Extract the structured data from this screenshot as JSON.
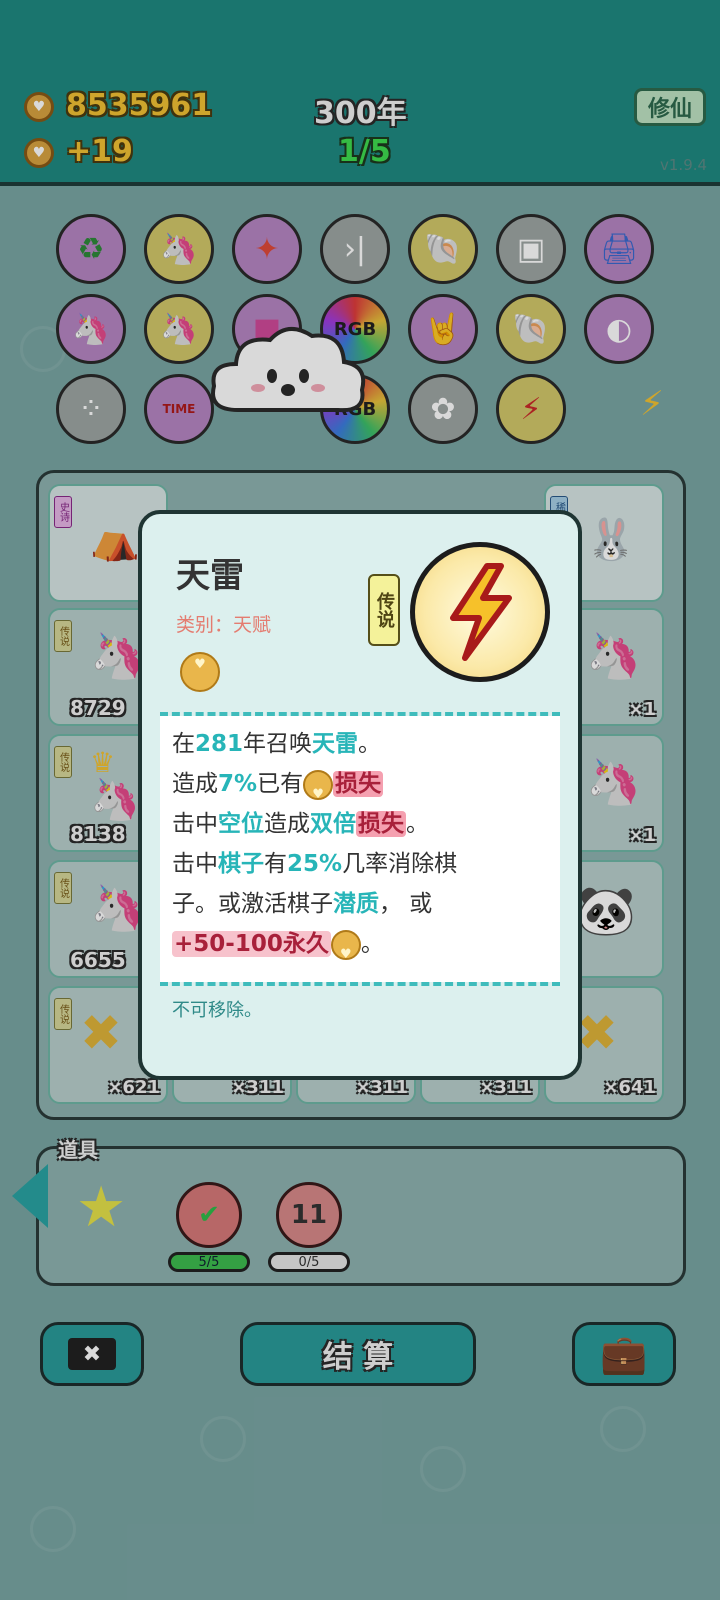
{
  "header": {
    "coins": "8535961",
    "income": "+19",
    "year": "300年",
    "progress": "1/5",
    "cultivate_label": "修仙",
    "version": "v1.9.4"
  },
  "item_bar": {
    "rows": [
      [
        "recycle-icon",
        "unicorn-icon",
        "compass-icon",
        "skip-icon",
        "shell-icon",
        "dice-icon",
        "printer-icon"
      ],
      [
        "twin-unicorn-icon",
        "unicorn-icon",
        "box-icon",
        "rgb-icon",
        "rock-hand-icon",
        "shell-icon",
        "gravy-boat-icon"
      ],
      [
        "egg-tray-icon",
        "time-magazine-icon",
        "cloud-icon",
        "rgb-icon",
        "flower-pot-icon",
        "lightning-icon"
      ]
    ],
    "rgb_label": "RGB"
  },
  "board": {
    "tags": {
      "legend": "传说",
      "epic": "史诗",
      "rare": "稀有"
    },
    "values": [
      "8729",
      "8138",
      "6655"
    ],
    "multipliers": [
      "×1",
      "×1",
      "×621",
      "×311",
      "×311",
      "×311",
      "×641"
    ]
  },
  "props": {
    "label": "道具",
    "items": [
      {
        "name": "star",
        "count": ""
      },
      {
        "name": "target-check",
        "count": "5/5"
      },
      {
        "name": "target-11",
        "value": "11",
        "count": "0/5"
      }
    ]
  },
  "buttons": {
    "settle_label": "结 算"
  },
  "popup": {
    "title": "天雷",
    "category": "类别：天赋",
    "rarity": "传说",
    "desc": {
      "l1a": "在",
      "l1b": "281",
      "l1c": "年召唤",
      "l1d": "天雷",
      "l1e": "。",
      "l2a": "造成",
      "l2b": "7%",
      "l2c": "已有",
      "l2d": "损失",
      "l3a": "击中",
      "l3b": "空位",
      "l3c": "造成",
      "l3d": "双倍",
      "l3e": "损失",
      "l3f": "。",
      "l4a": "击中",
      "l4b": "棋子",
      "l4c": "有",
      "l4d": "25%",
      "l4e": "几率消除棋",
      "l5a": "子。或激活棋子",
      "l5b": "潜质",
      "l5c": "，  或",
      "l6a": "+50-100永久",
      "l6b": "。"
    },
    "footnote": "不可移除。"
  },
  "colors": {
    "header_bg": "#1f8a82",
    "accent_cyan": "#27b5b8",
    "loss_red": "#a8203a"
  }
}
